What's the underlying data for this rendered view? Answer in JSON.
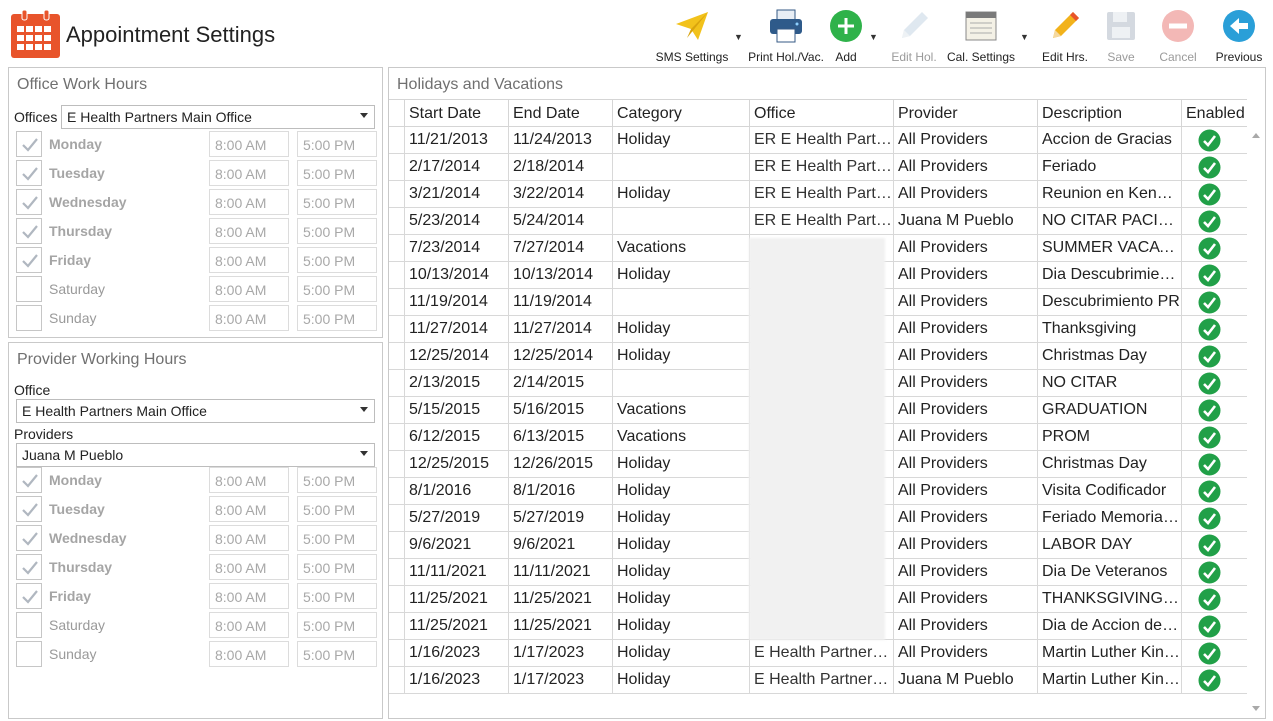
{
  "header": {
    "title": "Appointment Settings"
  },
  "toolbar": {
    "sms": "SMS Settings",
    "print": "Print Hol./Vac.",
    "add": "Add",
    "edit_hol": "Edit Hol.",
    "cal_settings": "Cal. Settings",
    "edit_hrs": "Edit Hrs.",
    "save": "Save",
    "cancel": "Cancel",
    "previous": "Previous"
  },
  "office_hours": {
    "title": "Office Work Hours",
    "offices_label": "Offices",
    "office_value": "E Health Partners Main Office",
    "days": [
      {
        "name": "Monday",
        "checked": true,
        "start": "8:00 AM",
        "end": "5:00 PM"
      },
      {
        "name": "Tuesday",
        "checked": true,
        "start": "8:00 AM",
        "end": "5:00 PM"
      },
      {
        "name": "Wednesday",
        "checked": true,
        "start": "8:00 AM",
        "end": "5:00 PM"
      },
      {
        "name": "Thursday",
        "checked": true,
        "start": "8:00 AM",
        "end": "5:00 PM"
      },
      {
        "name": "Friday",
        "checked": true,
        "start": "8:00 AM",
        "end": "5:00 PM"
      },
      {
        "name": "Saturday",
        "checked": false,
        "start": "8:00 AM",
        "end": "5:00 PM"
      },
      {
        "name": "Sunday",
        "checked": false,
        "start": "8:00 AM",
        "end": "5:00 PM"
      }
    ]
  },
  "provider_hours": {
    "title": "Provider Working Hours",
    "office_label": "Office",
    "office_value": "E Health Partners Main Office",
    "providers_label": "Providers",
    "provider_value": "Juana M Pueblo",
    "days": [
      {
        "name": "Monday",
        "checked": true,
        "start": "8:00 AM",
        "end": "5:00 PM"
      },
      {
        "name": "Tuesday",
        "checked": true,
        "start": "8:00 AM",
        "end": "5:00 PM"
      },
      {
        "name": "Wednesday",
        "checked": true,
        "start": "8:00 AM",
        "end": "5:00 PM"
      },
      {
        "name": "Thursday",
        "checked": true,
        "start": "8:00 AM",
        "end": "5:00 PM"
      },
      {
        "name": "Friday",
        "checked": true,
        "start": "8:00 AM",
        "end": "5:00 PM"
      },
      {
        "name": "Saturday",
        "checked": false,
        "start": "8:00 AM",
        "end": "5:00 PM"
      },
      {
        "name": "Sunday",
        "checked": false,
        "start": "8:00 AM",
        "end": "5:00 PM"
      }
    ]
  },
  "holidays": {
    "title": "Holidays and Vacations",
    "columns": [
      "Start Date",
      "End Date",
      "Category",
      "Office",
      "Provider",
      "Description",
      "Enabled"
    ],
    "rows": [
      [
        "11/21/2013",
        "11/24/2013",
        "Holiday",
        "ER E Health Partners",
        "All Providers",
        "Accion de Gracias"
      ],
      [
        "2/17/2014",
        "2/18/2014",
        "",
        "ER E Health Partners",
        "All Providers",
        "Feriado"
      ],
      [
        "3/21/2014",
        "3/22/2014",
        "Holiday",
        "ER E Health Partners",
        "All Providers",
        "Reunion en Kennedy"
      ],
      [
        "5/23/2014",
        "5/24/2014",
        "",
        "ER E Health Partners",
        "Juana M Pueblo",
        "NO CITAR PACIENTES"
      ],
      [
        "7/23/2014",
        "7/27/2014",
        "Vacations",
        "",
        "All Providers",
        "SUMMER VACATIONS"
      ],
      [
        "10/13/2014",
        "10/13/2014",
        "Holiday",
        "",
        "All Providers",
        "Dia Descubrimiento"
      ],
      [
        "11/19/2014",
        "11/19/2014",
        "",
        "",
        "All Providers",
        "Descubrimiento PR"
      ],
      [
        "11/27/2014",
        "11/27/2014",
        "Holiday",
        "",
        "All Providers",
        "Thanksgiving"
      ],
      [
        "12/25/2014",
        "12/25/2014",
        "Holiday",
        "",
        "All Providers",
        "Christmas Day"
      ],
      [
        "2/13/2015",
        "2/14/2015",
        "",
        "",
        "All Providers",
        "NO CITAR"
      ],
      [
        "5/15/2015",
        "5/16/2015",
        "Vacations",
        "",
        "All Providers",
        "GRADUATION"
      ],
      [
        "6/12/2015",
        "6/13/2015",
        "Vacations",
        "",
        "All Providers",
        "PROM"
      ],
      [
        "12/25/2015",
        "12/26/2015",
        "Holiday",
        "",
        "All Providers",
        "Christmas Day"
      ],
      [
        "8/1/2016",
        "8/1/2016",
        "Holiday",
        "",
        "All Providers",
        "Visita Codificador"
      ],
      [
        "5/27/2019",
        "5/27/2019",
        "Holiday",
        "",
        "All Providers",
        "Feriado Memorial Day"
      ],
      [
        "9/6/2021",
        "9/6/2021",
        "Holiday",
        "",
        "All Providers",
        "LABOR DAY"
      ],
      [
        "11/11/2021",
        "11/11/2021",
        "Holiday",
        "",
        "All Providers",
        "Dia De Veteranos"
      ],
      [
        "11/25/2021",
        "11/25/2021",
        "Holiday",
        "",
        "All Providers",
        "THANKSGIVING DAY"
      ],
      [
        "11/25/2021",
        "11/25/2021",
        "Holiday",
        "",
        "All Providers",
        "Dia de Accion de Gracias"
      ],
      [
        "1/16/2023",
        "1/17/2023",
        "Holiday",
        "E Health Partners Main Office",
        "All Providers",
        "Martin Luther King Day"
      ],
      [
        "1/16/2023",
        "1/17/2023",
        "Holiday",
        "E Health Partners Main Office",
        "Juana M Pueblo",
        "Martin Luther King Day"
      ]
    ]
  },
  "colors": {
    "accent": "#e8542b",
    "check": "#21a048",
    "add": "#2fb24a",
    "previous": "#2a9fd8"
  }
}
